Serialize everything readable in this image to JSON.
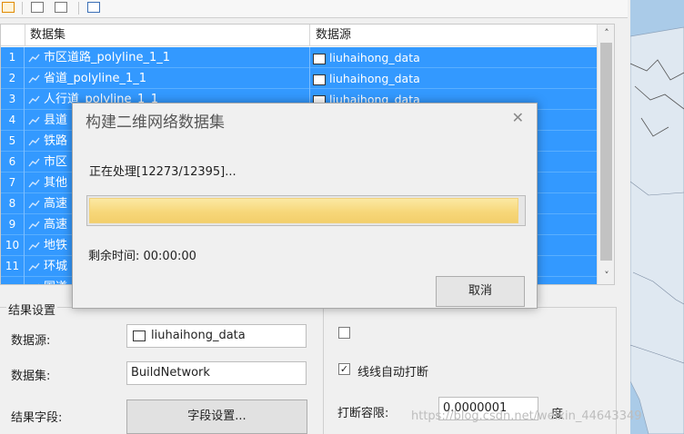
{
  "grid": {
    "columns": [
      "数据集",
      "数据源"
    ],
    "rows": [
      {
        "num": "1",
        "dataset": "市区道路_polyline_1_1",
        "source": "liuhaihong_data"
      },
      {
        "num": "2",
        "dataset": "省道_polyline_1_1",
        "source": "liuhaihong_data"
      },
      {
        "num": "3",
        "dataset": "人行道_polyline_1_1",
        "source": "liuhaihong_data"
      },
      {
        "num": "4",
        "dataset": "县道",
        "source": ""
      },
      {
        "num": "5",
        "dataset": "铁路",
        "source": ""
      },
      {
        "num": "6",
        "dataset": "市区",
        "source": ""
      },
      {
        "num": "7",
        "dataset": "其他",
        "source": ""
      },
      {
        "num": "8",
        "dataset": "高速",
        "source": ""
      },
      {
        "num": "9",
        "dataset": "高速",
        "source": ""
      },
      {
        "num": "10",
        "dataset": "地铁",
        "source": ""
      },
      {
        "num": "11",
        "dataset": "环城",
        "source": ""
      },
      {
        "num": "",
        "dataset": "国道",
        "source": ""
      }
    ]
  },
  "result_settings": {
    "title": "结果设置",
    "datasource_label": "数据源:",
    "datasource_value": "liuhaihong_data",
    "dataset_label": "数据集:",
    "dataset_value": "BuildNetwork",
    "fields_label": "结果字段:",
    "fields_button": "字段设置..."
  },
  "options": {
    "auto_break_label": "线线自动打断",
    "auto_break_checked": true,
    "tolerance_label": "打断容限:",
    "tolerance_value": "0.0000001",
    "tolerance_unit": "度"
  },
  "dialog": {
    "title": "构建二维网络数据集",
    "status": "正在处理[12273/12395]...",
    "progress_fraction": 0.99,
    "remaining": "剩余时间: 00:00:00",
    "cancel": "取消"
  },
  "watermark": "https://blog.csdn.net/weixin_44643349",
  "colors": {
    "selection": "#3399ff",
    "map_water": "#aacbe8",
    "progress": "#f7d77a"
  }
}
